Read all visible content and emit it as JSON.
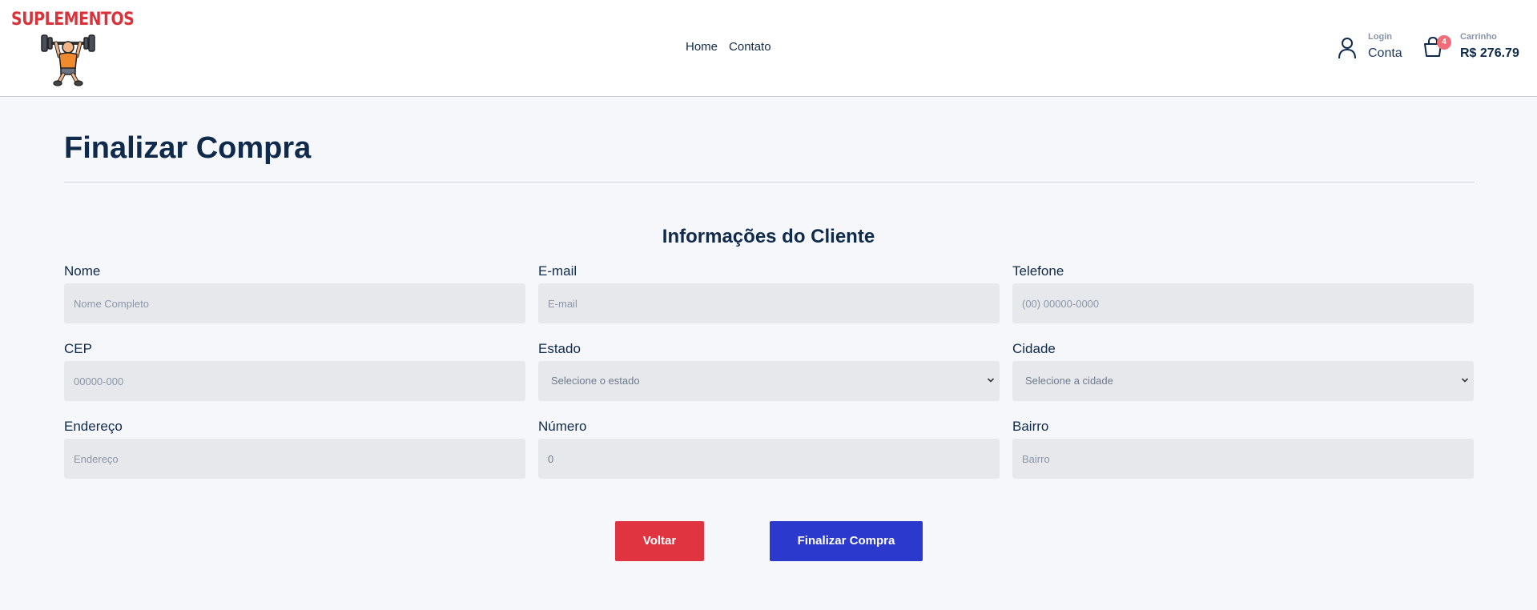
{
  "brand": {
    "name": "SUPLEMENTOS",
    "color": "#d8323b"
  },
  "nav": {
    "items": [
      {
        "label": "Home"
      },
      {
        "label": "Contato"
      }
    ]
  },
  "account": {
    "small_label": "Login",
    "label": "Conta",
    "icon": "user-icon"
  },
  "cart": {
    "small_label": "Carrinho",
    "total": "R$ 276.79",
    "count": "4",
    "icon": "shopping-bag-icon",
    "badge_color": "#f16d78"
  },
  "page": {
    "title": "Finalizar Compra",
    "section_title": "Informações do Cliente"
  },
  "form": {
    "nome": {
      "label": "Nome",
      "placeholder": "Nome Completo"
    },
    "email": {
      "label": "E-mail",
      "placeholder": "E-mail"
    },
    "telefone": {
      "label": "Telefone",
      "placeholder": "(00) 00000-0000"
    },
    "cep": {
      "label": "CEP",
      "placeholder": "00000-000"
    },
    "estado": {
      "label": "Estado",
      "selected": "Selecione o estado"
    },
    "cidade": {
      "label": "Cidade",
      "selected": "Selecione a cidade"
    },
    "endereco": {
      "label": "Endereço",
      "placeholder": "Endereço"
    },
    "numero": {
      "label": "Número",
      "value": "0"
    },
    "bairro": {
      "label": "Bairro",
      "placeholder": "Bairro"
    }
  },
  "actions": {
    "back_label": "Voltar",
    "finish_label": "Finalizar Compra",
    "back_color": "#e03440",
    "finish_color": "#2b3acd"
  }
}
